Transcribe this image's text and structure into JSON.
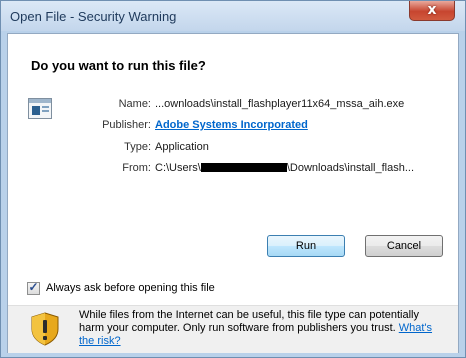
{
  "window": {
    "title": "Open File - Security Warning",
    "close_glyph": "x"
  },
  "dialog": {
    "heading": "Do you want to run this file?",
    "icon": "application-icon",
    "fields": {
      "name_label": "Name:",
      "name_value": "...ownloads\\install_flashplayer11x64_mssa_aih.exe",
      "publisher_label": "Publisher:",
      "publisher_value": "Adobe Systems Incorporated",
      "type_label": "Type:",
      "type_value": "Application",
      "from_label": "From:",
      "from_prefix": "C:\\Users\\",
      "from_suffix": "\\Downloads\\install_flash..."
    },
    "buttons": {
      "run": "Run",
      "cancel": "Cancel"
    },
    "checkbox": {
      "label": "Always ask before opening this file",
      "checked": true
    },
    "warning": {
      "icon": "shield-warning-icon",
      "text": "While files from the Internet can be useful, this file type can potentially harm your computer. Only run software from publishers you trust. ",
      "link": "What's the risk?"
    }
  },
  "colors": {
    "title_bar": "#c3d6ec",
    "link": "#0066cc",
    "close_button": "#c7452f",
    "footer_bg": "#f0f0f0"
  }
}
